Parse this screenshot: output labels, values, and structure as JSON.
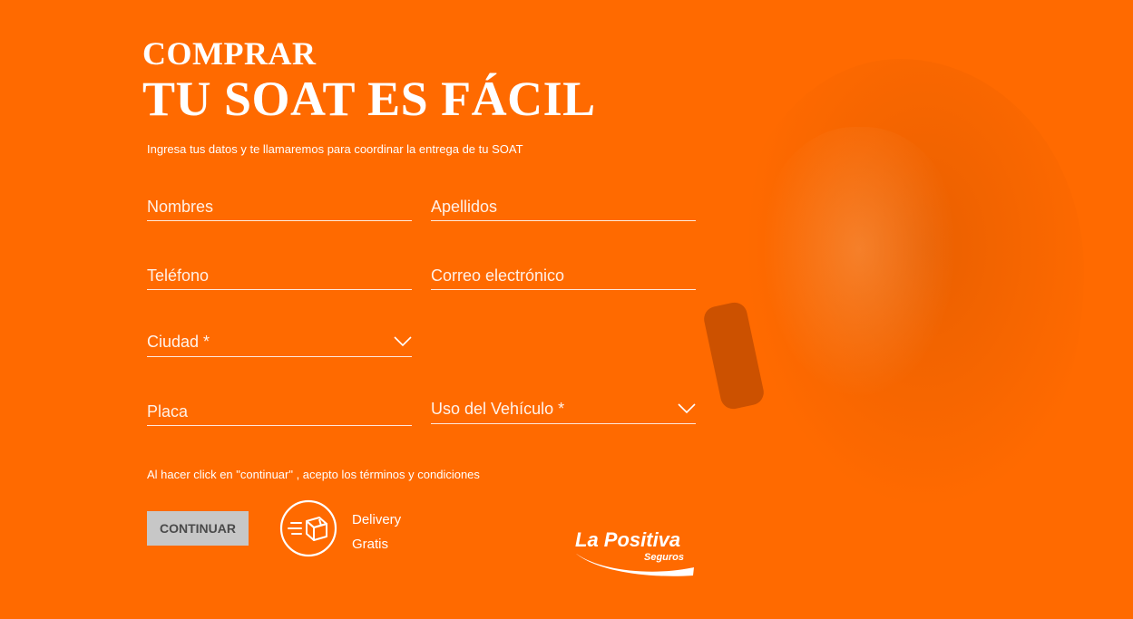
{
  "hero": {
    "line1": "COMPRAR",
    "line2": "TU SOAT ES FÁCIL",
    "subtitle": "Ingresa tus datos y te llamaremos para coordinar la entrega de tu SOAT"
  },
  "form": {
    "nombres_placeholder": "Nombres",
    "apellidos_placeholder": "Apellidos",
    "telefono_placeholder": "Teléfono",
    "correo_placeholder": "Correo electrónico",
    "ciudad_label": "Ciudad *",
    "placa_placeholder": "Placa",
    "uso_label": "Uso del Vehículo *"
  },
  "terms": "Al hacer click en \"continuar\" , acepto los términos y condiciones",
  "actions": {
    "continue_label": "CONTINUAR"
  },
  "delivery": {
    "line1": "Delivery",
    "line2": "Gratis",
    "icon": "delivery-box-icon"
  },
  "brand": {
    "name": "La Positiva",
    "tagline": "Seguros"
  },
  "colors": {
    "background": "#ff6a00",
    "button": "#c7c7c7",
    "text": "#ffffff"
  }
}
